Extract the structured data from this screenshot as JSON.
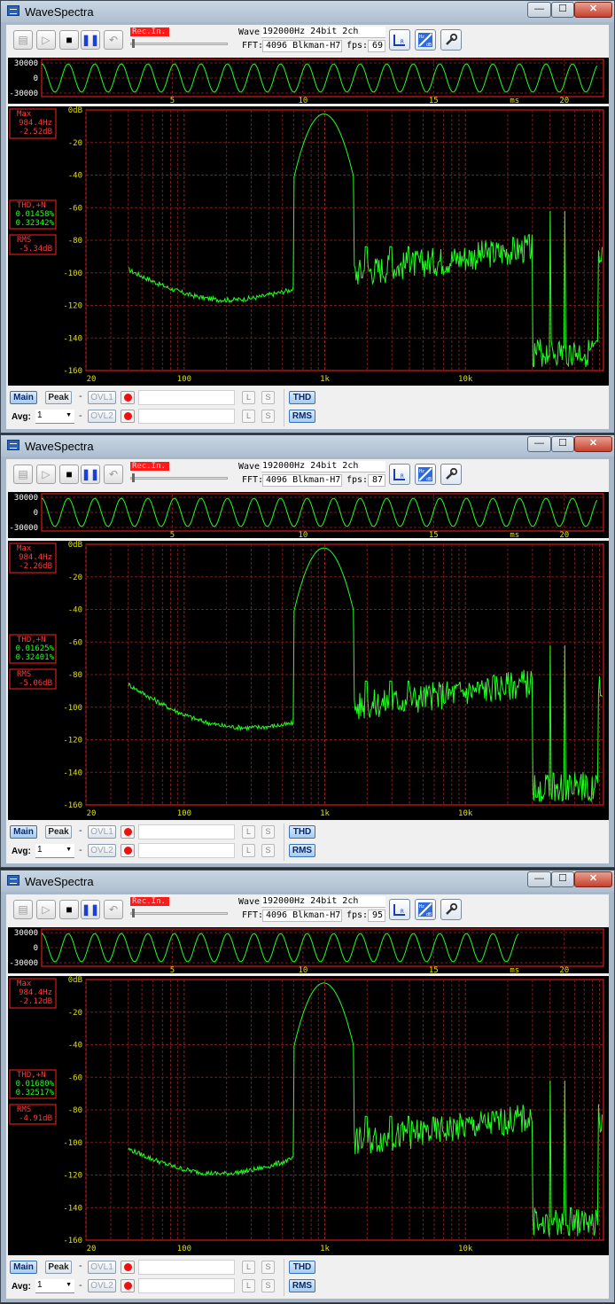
{
  "windows": [
    {
      "title": "WaveSpectra",
      "rec_in": "Rec.In.",
      "wave_label": "Wave:",
      "wave_value": "192000Hz 24bit 2ch",
      "fft_label": "FFT:",
      "fft_value": "4096 Blkman-H7",
      "fps_label": "fps:",
      "fps": "69",
      "wave_y_ticks": [
        "30000",
        "0",
        "-30000"
      ],
      "wave_x_ticks": [
        "5",
        "10",
        "15",
        "ms",
        "20"
      ],
      "wave_trace_end_ms": 21.3,
      "info": {
        "max_label": "Max",
        "max_freq": "984.4Hz",
        "max_level": "-2.52dB",
        "thd_label": "THD,+N",
        "thd": "0.01458%",
        "thdn": "0.32342%",
        "rms_label": "RMS",
        "rms": "-5.34dB"
      },
      "spectrum_floor_start_db": -98,
      "buttons": {
        "main": "Main",
        "peak": "Peak",
        "ovl1": "OVL1",
        "ovl2": "OVL2",
        "l": "L",
        "s": "S",
        "thd": "THD",
        "rms": "RMS",
        "avg_label": "Avg:",
        "avg_value": "1",
        "dash": "-",
        "close": "✕",
        "minimize": "—",
        "maximize": "☐"
      }
    },
    {
      "title": "WaveSpectra",
      "rec_in": "Rec.In.",
      "wave_label": "Wave:",
      "wave_value": "192000Hz 24bit 2ch",
      "fft_label": "FFT:",
      "fft_value": "4096 Blkman-H7",
      "fps_label": "fps:",
      "fps": "87",
      "wave_y_ticks": [
        "30000",
        "0",
        "-30000"
      ],
      "wave_x_ticks": [
        "5",
        "10",
        "15",
        "ms",
        "20"
      ],
      "wave_trace_end_ms": 21.3,
      "info": {
        "max_label": "Max",
        "max_freq": "984.4Hz",
        "max_level": "-2.26dB",
        "thd_label": "THD,+N",
        "thd": "0.01625%",
        "thdn": "0.32401%",
        "rms_label": "RMS",
        "rms": "-5.06dB"
      },
      "spectrum_floor_start_db": -86,
      "buttons": {
        "main": "Main",
        "peak": "Peak",
        "ovl1": "OVL1",
        "ovl2": "OVL2",
        "l": "L",
        "s": "S",
        "thd": "THD",
        "rms": "RMS",
        "avg_label": "Avg:",
        "avg_value": "1",
        "dash": "-",
        "close": "✕",
        "minimize": "—",
        "maximize": "☐"
      }
    },
    {
      "title": "WaveSpectra",
      "rec_in": "Rec.In.",
      "wave_label": "Wave:",
      "wave_value": "192000Hz 24bit 2ch",
      "fft_label": "FFT:",
      "fft_value": "4096 Blkman-H7",
      "fps_label": "fps:",
      "fps": "95",
      "wave_y_ticks": [
        "30000",
        "0",
        "-30000"
      ],
      "wave_x_ticks": [
        "5",
        "10",
        "15",
        "ms",
        "20"
      ],
      "wave_trace_end_ms": 18.3,
      "info": {
        "max_label": "Max",
        "max_freq": "984.4Hz",
        "max_level": "-2.12dB",
        "thd_label": "THD,+N",
        "thd": "0.01680%",
        "thdn": "0.32517%",
        "rms_label": "RMS",
        "rms": "-4.91dB"
      },
      "spectrum_floor_start_db": -104,
      "buttons": {
        "main": "Main",
        "peak": "Peak",
        "ovl1": "OVL1",
        "ovl2": "OVL2",
        "l": "L",
        "s": "S",
        "thd": "THD",
        "rms": "RMS",
        "avg_label": "Avg:",
        "avg_value": "1",
        "dash": "-",
        "close": "✕",
        "minimize": "—",
        "maximize": "☐"
      }
    }
  ],
  "spectrum_axes": {
    "y_ticks": [
      "0dB",
      "-20",
      "-40",
      "-60",
      "-80",
      "-100",
      "-120",
      "-140",
      "-160"
    ],
    "x_ticks": [
      "20",
      "100",
      "1k",
      "10k"
    ],
    "ylim": [
      -160,
      0
    ],
    "xlim_hz": [
      20,
      96000
    ]
  },
  "colors": {
    "trace": "#22ff22",
    "grid": "#7a1a1a",
    "frame": "#ff2020",
    "info_text": "#ff3a3a"
  }
}
